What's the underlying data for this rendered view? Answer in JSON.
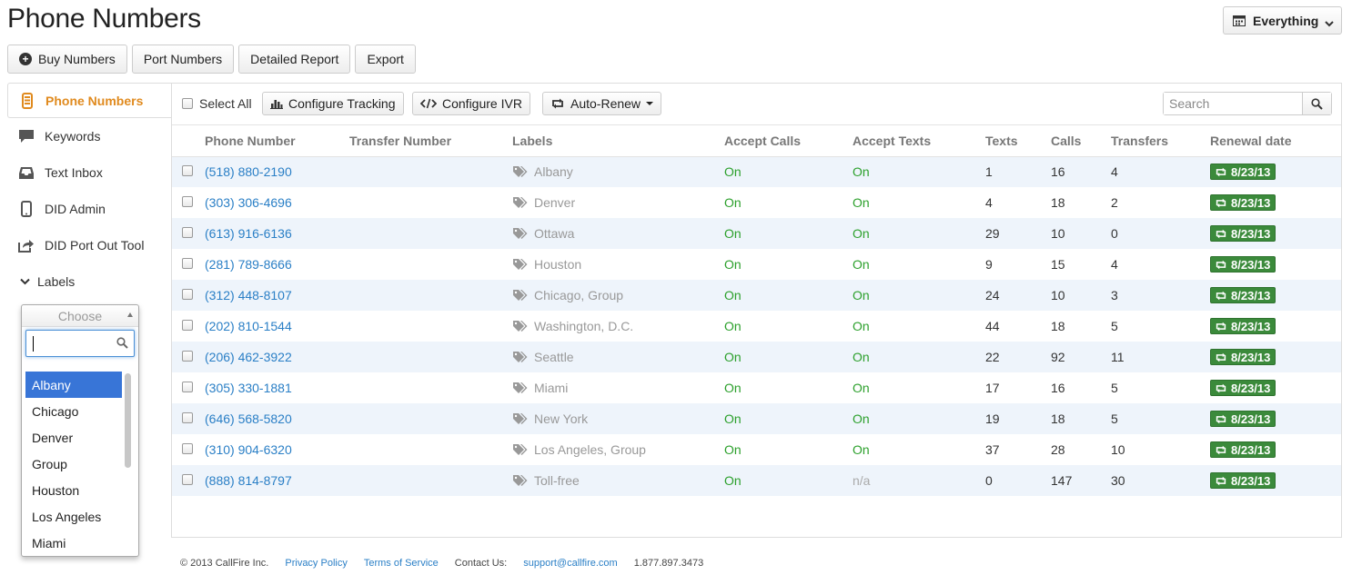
{
  "page": {
    "title": "Phone Numbers"
  },
  "filter": {
    "label": "Everything",
    "icon": "calendar-icon"
  },
  "top_buttons": [
    {
      "label": "Buy Numbers",
      "icon": "plus-circle-icon"
    },
    {
      "label": "Port Numbers"
    },
    {
      "label": "Detailed Report"
    },
    {
      "label": "Export"
    }
  ],
  "sidebar": {
    "items": [
      {
        "label": "Phone Numbers",
        "icon": "mobile-phone-icon",
        "active": true
      },
      {
        "label": "Keywords",
        "icon": "chat-bubble-icon"
      },
      {
        "label": "Text Inbox",
        "icon": "inbox-icon"
      },
      {
        "label": "DID Admin",
        "icon": "mobile-phone-icon"
      },
      {
        "label": "DID Port Out Tool",
        "icon": "share-icon"
      }
    ],
    "labels_toggle": "Labels",
    "chooser": {
      "placeholder": "Choose",
      "search_value": "",
      "options": [
        "Albany",
        "Chicago",
        "Denver",
        "Group",
        "Houston",
        "Los Angeles",
        "Miami"
      ],
      "selected": "Albany"
    }
  },
  "toolbar": {
    "select_all": "Select All",
    "configure_tracking": "Configure Tracking",
    "configure_ivr": "Configure IVR",
    "auto_renew": "Auto-Renew",
    "search_placeholder": "Search"
  },
  "table": {
    "columns": [
      "Phone Number",
      "Transfer Number",
      "Labels",
      "Accept Calls",
      "Accept Texts",
      "Texts",
      "Calls",
      "Transfers",
      "Renewal date"
    ],
    "rows": [
      {
        "phone": "(518) 880-2190",
        "transfer": "",
        "labels": "Albany",
        "accept_calls": "On",
        "accept_texts": "On",
        "texts": "1",
        "calls": "16",
        "transfers": "4",
        "renewal": "8/23/13"
      },
      {
        "phone": "(303) 306-4696",
        "transfer": "",
        "labels": "Denver",
        "accept_calls": "On",
        "accept_texts": "On",
        "texts": "4",
        "calls": "18",
        "transfers": "2",
        "renewal": "8/23/13"
      },
      {
        "phone": "(613) 916-6136",
        "transfer": "",
        "labels": "Ottawa",
        "accept_calls": "On",
        "accept_texts": "On",
        "texts": "29",
        "calls": "10",
        "transfers": "0",
        "renewal": "8/23/13"
      },
      {
        "phone": "(281) 789-8666",
        "transfer": "",
        "labels": "Houston",
        "accept_calls": "On",
        "accept_texts": "On",
        "texts": "9",
        "calls": "15",
        "transfers": "4",
        "renewal": "8/23/13"
      },
      {
        "phone": "(312) 448-8107",
        "transfer": "",
        "labels": "Chicago, Group",
        "accept_calls": "On",
        "accept_texts": "On",
        "texts": "24",
        "calls": "10",
        "transfers": "3",
        "renewal": "8/23/13"
      },
      {
        "phone": "(202) 810-1544",
        "transfer": "",
        "labels": "Washington, D.C.",
        "accept_calls": "On",
        "accept_texts": "On",
        "texts": "44",
        "calls": "18",
        "transfers": "5",
        "renewal": "8/23/13"
      },
      {
        "phone": "(206) 462-3922",
        "transfer": "",
        "labels": "Seattle",
        "accept_calls": "On",
        "accept_texts": "On",
        "texts": "22",
        "calls": "92",
        "transfers": "11",
        "renewal": "8/23/13"
      },
      {
        "phone": "(305) 330-1881",
        "transfer": "",
        "labels": "Miami",
        "accept_calls": "On",
        "accept_texts": "On",
        "texts": "17",
        "calls": "16",
        "transfers": "5",
        "renewal": "8/23/13"
      },
      {
        "phone": "(646) 568-5820",
        "transfer": "",
        "labels": "New York",
        "accept_calls": "On",
        "accept_texts": "On",
        "texts": "19",
        "calls": "18",
        "transfers": "5",
        "renewal": "8/23/13"
      },
      {
        "phone": "(310) 904-6320",
        "transfer": "",
        "labels": "Los Angeles, Group",
        "accept_calls": "On",
        "accept_texts": "On",
        "texts": "37",
        "calls": "28",
        "transfers": "10",
        "renewal": "8/23/13"
      },
      {
        "phone": "(888) 814-8797",
        "transfer": "",
        "labels": "Toll-free",
        "accept_calls": "On",
        "accept_texts": "n/a",
        "texts": "0",
        "calls": "147",
        "transfers": "30",
        "renewal": "8/23/13"
      }
    ]
  },
  "footer": {
    "copyright": "© 2013 CallFire Inc.",
    "privacy": "Privacy Policy",
    "terms": "Terms of Service",
    "contact_label": "Contact Us:",
    "email": "support@callfire.com",
    "phone": "1.877.897.3473"
  },
  "colors": {
    "accent_orange": "#e08a1e",
    "link_blue": "#2a7fc6",
    "on_green": "#2ca02c",
    "renew_green": "#3b8a3b",
    "stripe": "#eef4fb",
    "selected_option": "#3875d7"
  }
}
